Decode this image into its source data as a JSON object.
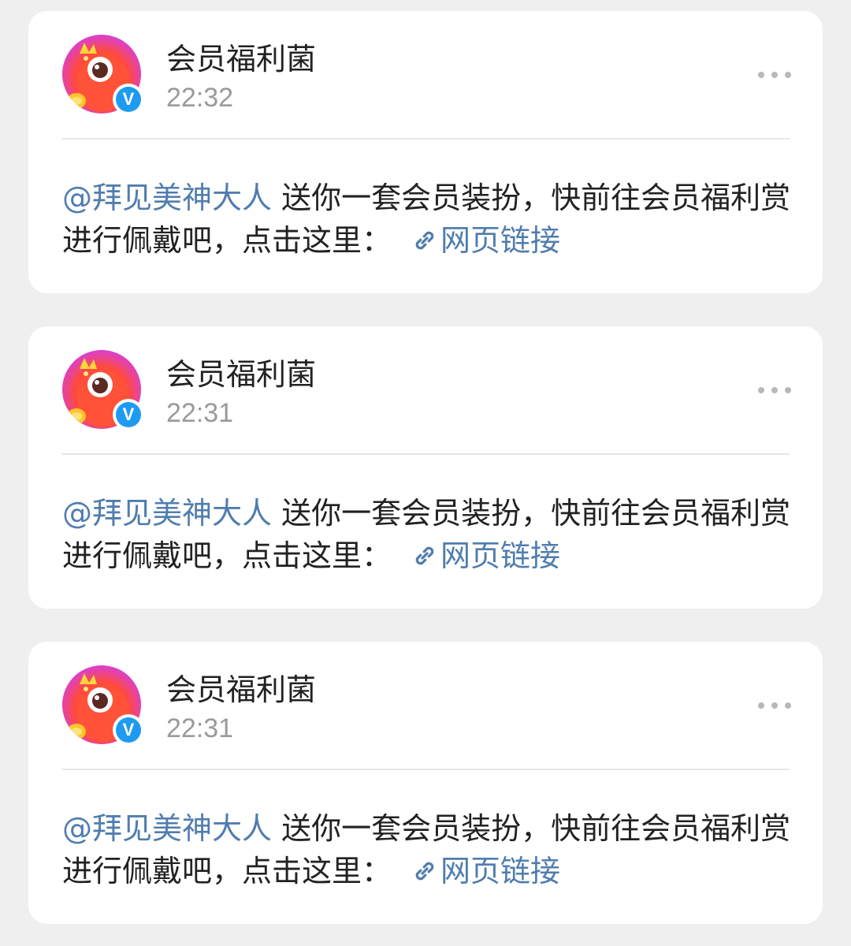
{
  "posts": [
    {
      "author": "会员福利菌",
      "time": "22:32",
      "mention": "@拜见美神大人",
      "text": " 送你一套会员装扮，快前往会员福利赏进行佩戴吧，点击这里：",
      "link_text": "网页链接",
      "verified_badge": "V"
    },
    {
      "author": "会员福利菌",
      "time": "22:31",
      "mention": "@拜见美神大人",
      "text": " 送你一套会员装扮，快前往会员福利赏进行佩戴吧，点击这里：",
      "link_text": "网页链接",
      "verified_badge": "V"
    },
    {
      "author": "会员福利菌",
      "time": "22:31",
      "mention": "@拜见美神大人",
      "text": " 送你一套会员装扮，快前往会员福利赏进行佩戴吧，点击这里：",
      "link_text": "网页链接",
      "verified_badge": "V"
    }
  ],
  "icons": {
    "avatar": "monster-avatar-icon",
    "verified": "verified-v-icon",
    "more": "more-horizontal-icon",
    "link": "chain-link-icon"
  },
  "colors": {
    "background": "#efefef",
    "card": "#ffffff",
    "link": "#507daf",
    "verified": "#1e9bf0",
    "time": "#9a9a9a"
  }
}
